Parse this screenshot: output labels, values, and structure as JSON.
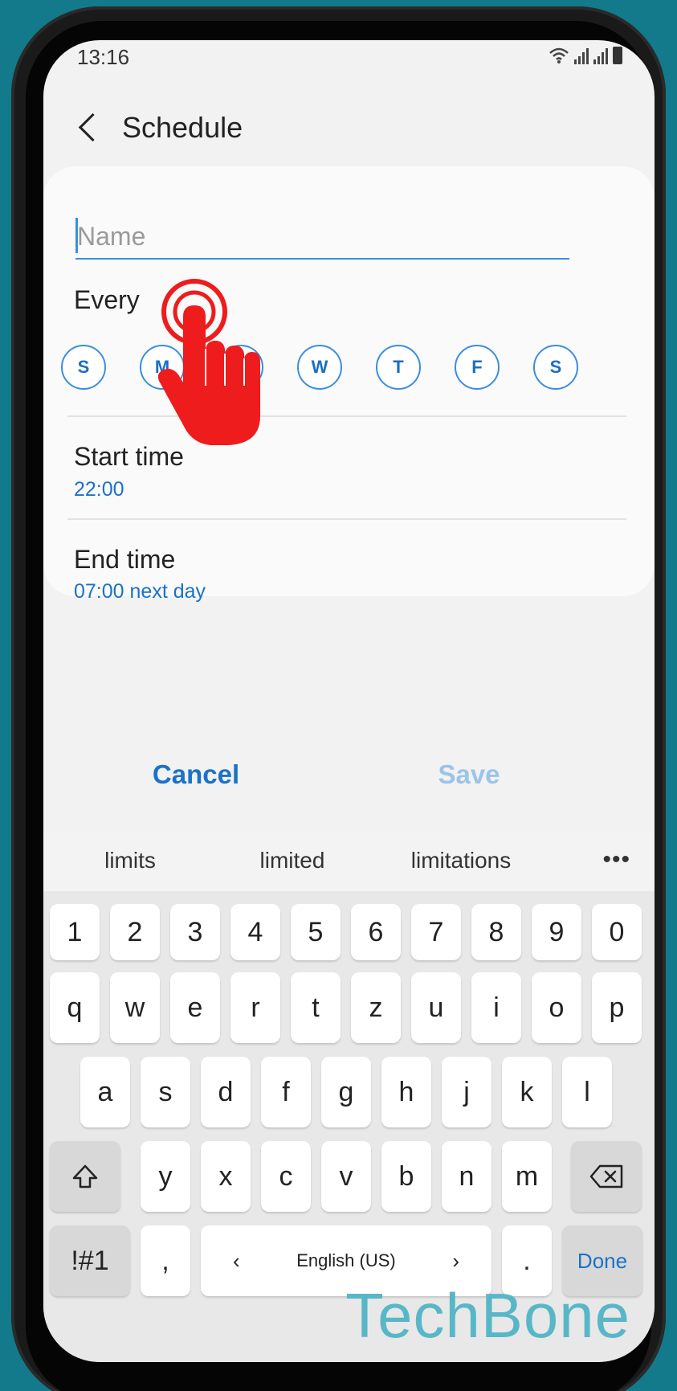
{
  "status_bar": {
    "time": "13:16"
  },
  "header": {
    "title": "Schedule",
    "back_icon": "chevron-left-icon"
  },
  "name_field": {
    "placeholder": "Name",
    "value": ""
  },
  "repeat": {
    "label": "Every",
    "days": [
      "S",
      "M",
      "T",
      "W",
      "T",
      "F",
      "S"
    ]
  },
  "start_time": {
    "label": "Start time",
    "value": "22:00"
  },
  "end_time": {
    "label": "End time",
    "value": "07:00 next day"
  },
  "actions": {
    "cancel": "Cancel",
    "save": "Save"
  },
  "keyboard": {
    "suggestions": [
      "limits",
      "limited",
      "limitations"
    ],
    "more_icon": "more-horizontal-icon",
    "row_numbers": [
      "1",
      "2",
      "3",
      "4",
      "5",
      "6",
      "7",
      "8",
      "9",
      "0"
    ],
    "row_1": [
      "q",
      "w",
      "e",
      "r",
      "t",
      "z",
      "u",
      "i",
      "o",
      "p"
    ],
    "row_2": [
      "a",
      "s",
      "d",
      "f",
      "g",
      "h",
      "j",
      "k",
      "l"
    ],
    "row_3": [
      "y",
      "x",
      "c",
      "v",
      "b",
      "n",
      "m"
    ],
    "symbols_key": "!#1",
    "comma_key": ",",
    "language": "English (US)",
    "period_key": ".",
    "done_key": "Done"
  },
  "watermark": "TechBone",
  "colors": {
    "accent": "#1a72c9",
    "underline": "#3a8ee0",
    "hand": "#ee1c1c",
    "background": "#127a8a"
  }
}
